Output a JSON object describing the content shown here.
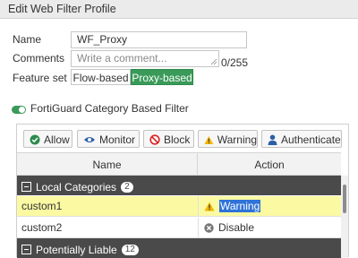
{
  "window": {
    "title": "Edit Web Filter Profile"
  },
  "form": {
    "name_label": "Name",
    "name_value": "WF_Proxy",
    "comments_label": "Comments",
    "comments_placeholder": "Write a comment...",
    "char_count": "0/255",
    "feature_set_label": "Feature set",
    "feature_options": [
      "Flow-based",
      "Proxy-based"
    ],
    "feature_selected": "Proxy-based"
  },
  "fortiguard": {
    "enabled": true,
    "title": "FortiGuard Category Based Filter"
  },
  "toolbar": {
    "allow": "Allow",
    "monitor": "Monitor",
    "block": "Block",
    "warning": "Warning",
    "authenticate": "Authenticate"
  },
  "table": {
    "columns": [
      "Name",
      "Action"
    ],
    "groups": [
      {
        "label": "Local Categories",
        "count": "2",
        "rows": [
          {
            "name": "custom1",
            "action": "Warning",
            "action_icon": "warning-icon",
            "highlighted": true
          },
          {
            "name": "custom2",
            "action": "Disable",
            "action_icon": "disable-icon",
            "highlighted": false
          }
        ]
      },
      {
        "label": "Potentially Liable",
        "count": "12"
      }
    ]
  },
  "colors": {
    "accent_green": "#3a9a59",
    "group_header": "#4a4a4a",
    "row_highlight": "#fbfaa3",
    "selection": "#2f73d8"
  }
}
